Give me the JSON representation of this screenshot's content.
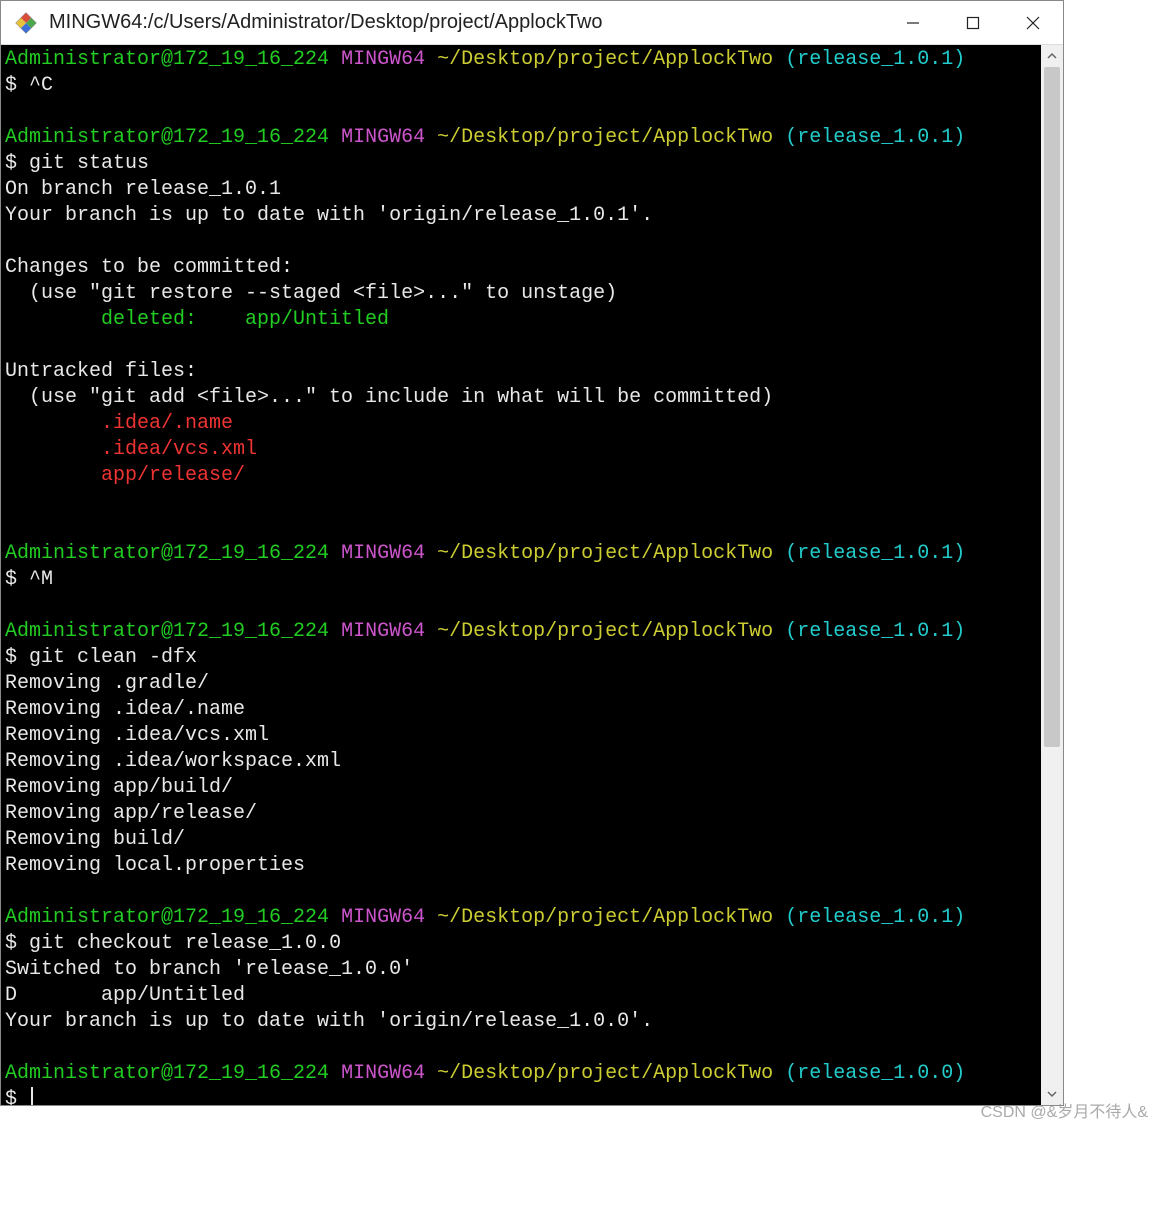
{
  "window": {
    "title": "MINGW64:/c/Users/Administrator/Desktop/project/ApplockTwo"
  },
  "prompt": {
    "user_host": "Administrator@172_19_16_224",
    "shell": "MINGW64",
    "path": "~/Desktop/project/ApplockTwo",
    "branch1": "(release_1.0.1)",
    "branch0": "(release_1.0.0)",
    "sym": "$ "
  },
  "cmd": {
    "ctrl_c": "^C",
    "git_status": "git status",
    "ctrl_m": "^M",
    "git_clean": "git clean -dfx",
    "git_checkout": "git checkout release_1.0.0"
  },
  "status": {
    "on_branch": "On branch release_1.0.1",
    "uptodate1": "Your branch is up to date with 'origin/release_1.0.1'.",
    "changes_hdr": "Changes to be committed:",
    "unstage_hint": "  (use \"git restore --staged <file>...\" to unstage)",
    "deleted": "        deleted:    app/Untitled",
    "untracked_hdr": "Untracked files:",
    "include_hint": "  (use \"git add <file>...\" to include in what will be committed)",
    "u1": "        .idea/.name",
    "u2": "        .idea/vcs.xml",
    "u3": "        app/release/"
  },
  "clean": {
    "r1": "Removing .gradle/",
    "r2": "Removing .idea/.name",
    "r3": "Removing .idea/vcs.xml",
    "r4": "Removing .idea/workspace.xml",
    "r5": "Removing app/build/",
    "r6": "Removing app/release/",
    "r7": "Removing build/",
    "r8": "Removing local.properties"
  },
  "checkout": {
    "switched": "Switched to branch 'release_1.0.0'",
    "dline": "D       app/Untitled",
    "uptodate0": "Your branch is up to date with 'origin/release_1.0.0'."
  },
  "watermark": "CSDN @&岁月不待人&"
}
